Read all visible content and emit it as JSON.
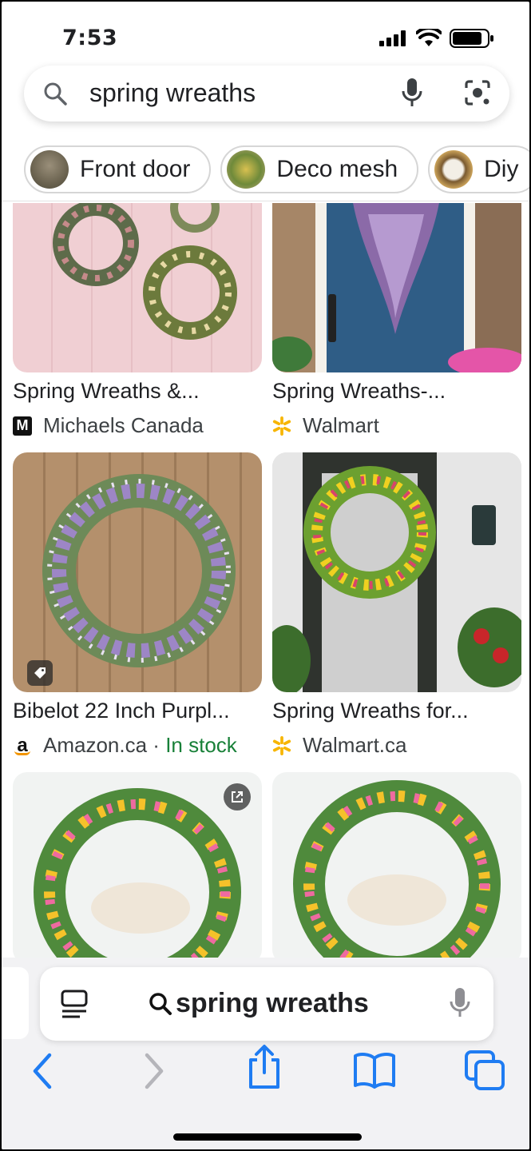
{
  "status": {
    "time": "7:53"
  },
  "search": {
    "query": "spring wreaths"
  },
  "chips": [
    {
      "label": "Front door"
    },
    {
      "label": "Deco mesh"
    },
    {
      "label": "Diy"
    }
  ],
  "results": [
    {
      "title": "Spring Wreaths &...",
      "source": "Michaels Canada",
      "stock": ""
    },
    {
      "title": "Spring Wreaths-...",
      "source": "Walmart",
      "stock": ""
    },
    {
      "title": "Bibelot 22 Inch Purpl...",
      "source": "Amazon.ca",
      "sep": " · ",
      "stock": "In stock"
    },
    {
      "title": "Spring Wreaths for...",
      "source": "Walmart.ca",
      "stock": ""
    }
  ],
  "browser": {
    "address_text": "spring wreaths"
  },
  "colors": {
    "accent": "#1a73e8",
    "safari_blue": "#1f7cf2",
    "in_stock": "#188038"
  }
}
